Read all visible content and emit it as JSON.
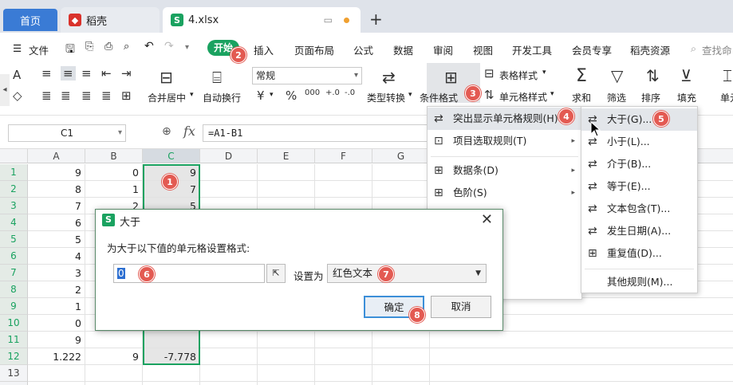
{
  "tabs": {
    "home": "首页",
    "daoke": "稻壳",
    "file": "4.xlsx",
    "add": "+"
  },
  "menubar": {
    "file": "文件",
    "start": "开始",
    "items": [
      "插入",
      "页面布局",
      "公式",
      "数据",
      "审阅",
      "视图",
      "开发工具",
      "会员专享",
      "稻壳资源"
    ],
    "search": "查找命"
  },
  "ribbon": {
    "font_name": "常规",
    "merge": "合并居中",
    "wrap": "自动换行",
    "type_convert": "类型转换",
    "conditional_format": "条件格式",
    "table_style": "表格样式",
    "cell_style": "单元格样式",
    "sum": "求和",
    "filter": "筛选",
    "sort": "排序",
    "fill": "填充",
    "single": "单元"
  },
  "formula": {
    "name_box": "C1",
    "fx": "fx",
    "content": "=A1-B1"
  },
  "grid": {
    "columns": [
      "A",
      "B",
      "C",
      "D",
      "E",
      "F",
      "G"
    ],
    "rows": [
      {
        "n": "1",
        "a": "9",
        "b": "0",
        "c": "9"
      },
      {
        "n": "2",
        "a": "8",
        "b": "1",
        "c": "7"
      },
      {
        "n": "3",
        "a": "7",
        "b": "2",
        "c": "5"
      },
      {
        "n": "4",
        "a": "6",
        "b": "",
        "c": ""
      },
      {
        "n": "5",
        "a": "5",
        "b": "",
        "c": ""
      },
      {
        "n": "6",
        "a": "4",
        "b": "",
        "c": ""
      },
      {
        "n": "7",
        "a": "3",
        "b": "",
        "c": ""
      },
      {
        "n": "8",
        "a": "2",
        "b": "",
        "c": ""
      },
      {
        "n": "9",
        "a": "1",
        "b": "",
        "c": ""
      },
      {
        "n": "10",
        "a": "0",
        "b": "",
        "c": ""
      },
      {
        "n": "11",
        "a": "9",
        "b": "",
        "c": ""
      },
      {
        "n": "12",
        "a": "1.222",
        "b": "9",
        "c": "-7.778"
      },
      {
        "n": "13",
        "a": "",
        "b": "",
        "c": ""
      },
      {
        "n": "14",
        "a": "",
        "b": "",
        "c": ""
      }
    ]
  },
  "menu_conditional": {
    "highlight_rules": "突出显示单元格规则(H)",
    "top_rules": "项目选取规则(T)",
    "data_bar": "数据条(D)",
    "color_scale": "色阶(S)"
  },
  "menu_highlight": {
    "greater": "大于(G)...",
    "less": "小于(L)...",
    "between": "介于(B)...",
    "equal": "等于(E)...",
    "text_contains": "文本包含(T)...",
    "date": "发生日期(A)...",
    "duplicate": "重复值(D)...",
    "other": "其他规则(M)..."
  },
  "dialog": {
    "title": "大于",
    "prompt": "为大于以下值的单元格设置格式:",
    "value": "0",
    "set_as": "设置为",
    "format": "红色文本",
    "ok": "确定",
    "cancel": "取消"
  },
  "badges": [
    "1",
    "2",
    "3",
    "4",
    "5",
    "6",
    "7",
    "8"
  ],
  "colors": {
    "brand_green": "#1aa260",
    "home_tab_blue": "#3a7bd5",
    "badge_red": "#e35a52"
  }
}
